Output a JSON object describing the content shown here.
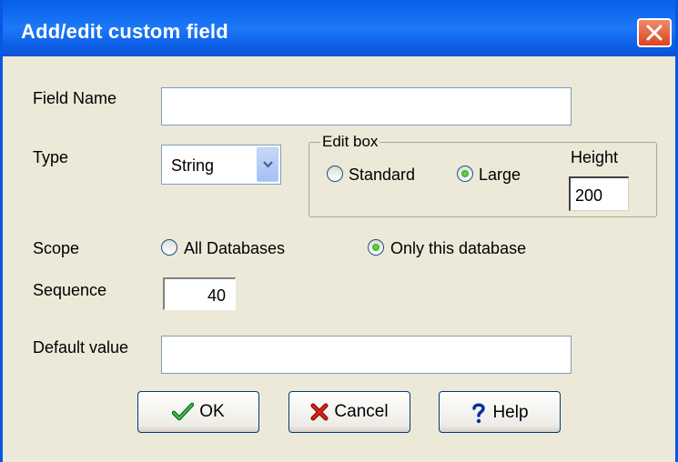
{
  "window": {
    "title": "Add/edit custom field",
    "close_icon": "close-icon"
  },
  "field_name": {
    "label": "Field Name",
    "value": ""
  },
  "type": {
    "label": "Type",
    "selected": "String"
  },
  "edit_box": {
    "legend": "Edit box",
    "options": [
      {
        "label": "Standard",
        "checked": false
      },
      {
        "label": "Large",
        "checked": true
      }
    ],
    "height_label": "Height",
    "height_value": "200"
  },
  "scope": {
    "label": "Scope",
    "options": [
      {
        "label": "All Databases",
        "checked": false
      },
      {
        "label": "Only this database",
        "checked": true
      }
    ]
  },
  "sequence": {
    "label": "Sequence",
    "value": "40"
  },
  "default_value": {
    "label": "Default value",
    "value": ""
  },
  "buttons": {
    "ok": {
      "label": "OK",
      "icon": "checkmark-icon"
    },
    "cancel": {
      "label": "Cancel",
      "icon": "x-icon"
    },
    "help": {
      "label": "Help",
      "icon": "question-icon"
    }
  },
  "colors": {
    "titlebar": "#0b64ed",
    "dialog_bg": "#ece9d8",
    "close_button": "#d8461f"
  }
}
